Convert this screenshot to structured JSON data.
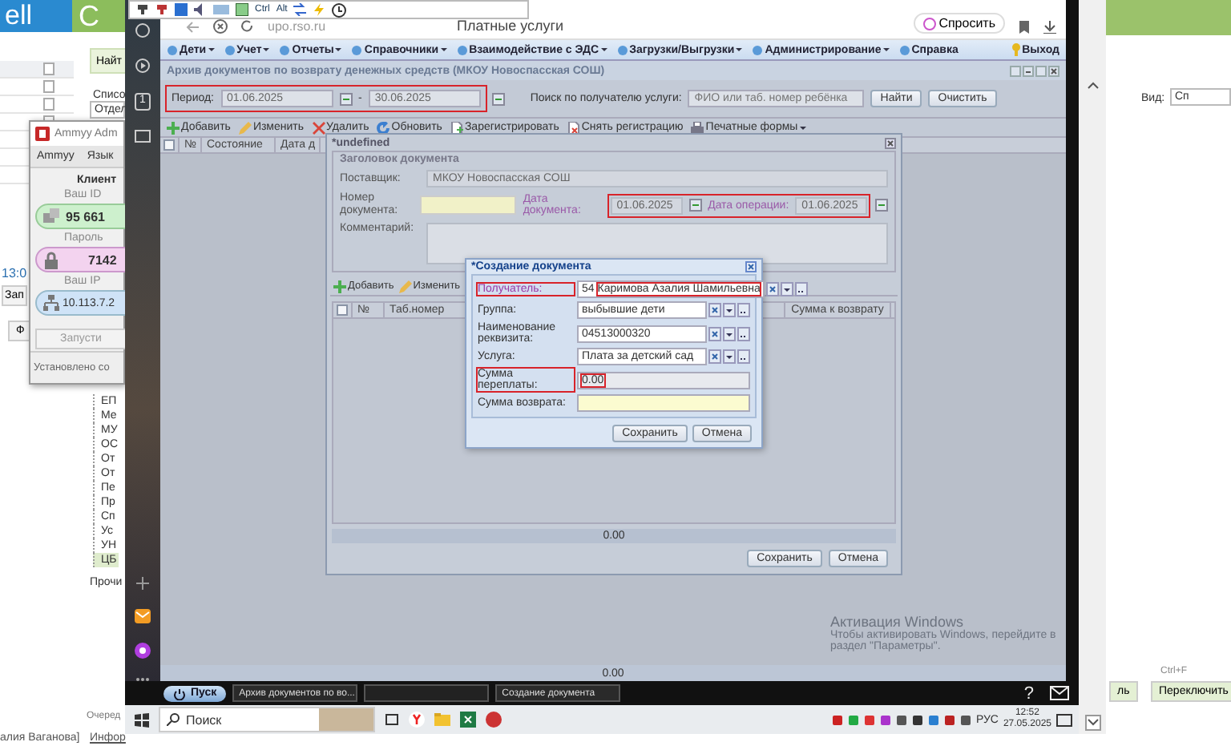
{
  "local_app": {
    "header_left": "ell",
    "header_mid": "C",
    "search_button": "Найт",
    "list_label": "Списо",
    "department_field": "Отдел",
    "time": "13:0",
    "record_button": "Зап",
    "button_2": "Ф",
    "tree_items": [
      "ЕП",
      "Ме",
      "МУ",
      "ОС",
      "От",
      "От",
      "Пе",
      "Пр",
      "Сп",
      "Ус",
      "УН",
      "ЦБ"
    ],
    "other_item": "Прочи",
    "view_label": "Вид:",
    "view_value": "Сп",
    "shortcut": "Ctrl+F",
    "switch_button": "Переключить",
    "button_3": "ль",
    "queue": "Очеред",
    "user": "алия Ваганова]",
    "info": "Инфор"
  },
  "ammyy": {
    "title": "Ammyy Adm",
    "menu": [
      "Ammyy",
      "Язык"
    ],
    "section": "Клиент",
    "id_label": "Ваш ID",
    "id": "95 661",
    "password_label": "Пароль",
    "password": "7142",
    "ip_label": "Ваш IP",
    "ip": "10.113.7.2",
    "start_button": "Запусти",
    "status": "Установлено со"
  },
  "remote_toolbar": {
    "labels": [
      "Ctrl",
      "Alt"
    ]
  },
  "sidebar": {
    "badge": "1"
  },
  "browser": {
    "url": "upo.rso.ru",
    "title": "Платные услуги",
    "ask_button": "Спросить"
  },
  "menu": [
    {
      "label": "Дети",
      "dropdown": true
    },
    {
      "label": "Учет",
      "dropdown": true
    },
    {
      "label": "Отчеты",
      "dropdown": true
    },
    {
      "label": "Справочники",
      "dropdown": true
    },
    {
      "label": "Взаимодействие с ЭДС",
      "dropdown": true
    },
    {
      "label": "Загрузки/Выгрузки",
      "dropdown": true
    },
    {
      "label": "Администрирование",
      "dropdown": true
    },
    {
      "label": "Справка",
      "dropdown": false
    }
  ],
  "logout": "Выход",
  "archive": {
    "title": "Архив документов по возврату денежных средств (МКОУ Новоспасская СОШ)",
    "period": {
      "label": "Период:",
      "from": "01.06.2025",
      "separator": "-",
      "to": "30.06.2025",
      "highlighted": true
    },
    "search": {
      "label": "Поиск по получателю услуги:",
      "placeholder": "ФИО или таб. номер ребёнка"
    },
    "buttons": [
      "Найти",
      "Очистить"
    ],
    "toolbar": [
      {
        "label": "Добавить",
        "kind": "add",
        "dropdown": false
      },
      {
        "label": "Изменить",
        "kind": "edit",
        "dropdown": false
      },
      {
        "label": "Удалить",
        "kind": "delete",
        "dropdown": false
      },
      {
        "label": "Обновить",
        "kind": "refresh",
        "dropdown": false
      },
      {
        "label": "Зарегистрировать",
        "kind": "register",
        "dropdown": false
      },
      {
        "label": "Снять регистрацию",
        "kind": "unregister",
        "dropdown": false
      },
      {
        "label": "Печатные формы",
        "kind": "print",
        "dropdown": true
      }
    ],
    "select_all_checked": false,
    "columns": [
      "№",
      "Состояние",
      "Дата д"
    ],
    "total": "0.00"
  },
  "document_dialog": {
    "title": "*undefined",
    "group_title": "Заголовок документа",
    "supplier_label": "Поставщик:",
    "supplier": "МКОУ Новоспасская СОШ",
    "number_label": "Номер документа:",
    "doc_date_label": "Дата документа:",
    "doc_date": "01.06.2025",
    "op_date_label": "Дата операции:",
    "op_date": "01.06.2025",
    "dates_highlighted": true,
    "comment_label": "Комментарий:",
    "toolbar": [
      {
        "label": "Добавить",
        "kind": "add"
      },
      {
        "label": "Изменить",
        "kind": "edit"
      }
    ],
    "select_all_checked": false,
    "columns": [
      "№",
      "Таб.номер",
      "Сумма к возврату"
    ],
    "total": "0.00",
    "buttons": [
      "Сохранить",
      "Отмена"
    ]
  },
  "create_dialog": {
    "title": "*Создание документа",
    "fields": [
      {
        "label": "Получатель:",
        "kind": "combo",
        "prefix": "54",
        "value": "Каримова Азалия Шамильевна",
        "highlighted": true,
        "required": true
      },
      {
        "label": "Группа:",
        "kind": "combo",
        "value": "выбывшие дети",
        "highlighted": false,
        "required": false
      },
      {
        "label": "Наименование реквизита:",
        "kind": "combo",
        "value": "04513000320",
        "highlighted": false,
        "required": false
      },
      {
        "label": "Услуга:",
        "kind": "combo",
        "value": "Плата за детский сад",
        "highlighted": false,
        "required": false
      },
      {
        "label": "Сумма переплаты:",
        "kind": "readonly",
        "value": "0.00",
        "highlighted": true,
        "required": false
      },
      {
        "label": "Сумма возврата:",
        "kind": "input",
        "highlighted": false,
        "required": false
      }
    ],
    "buttons": [
      "Сохранить",
      "Отмена"
    ]
  },
  "activation": {
    "title": "Активация Windows",
    "text": "Чтобы активировать Windows, перейдите в раздел \"Параметры\"."
  },
  "inner_taskbar": {
    "start": "Пуск",
    "tasks": [
      {
        "kind": "window",
        "label": "Архив документов по во..."
      },
      {
        "kind": "empty"
      },
      {
        "kind": "window",
        "label": "Создание документа"
      }
    ],
    "help": "?"
  },
  "win_taskbar": {
    "search": "Поиск",
    "lang": "РУС",
    "time": "12:52",
    "date": "27.05.2025"
  }
}
